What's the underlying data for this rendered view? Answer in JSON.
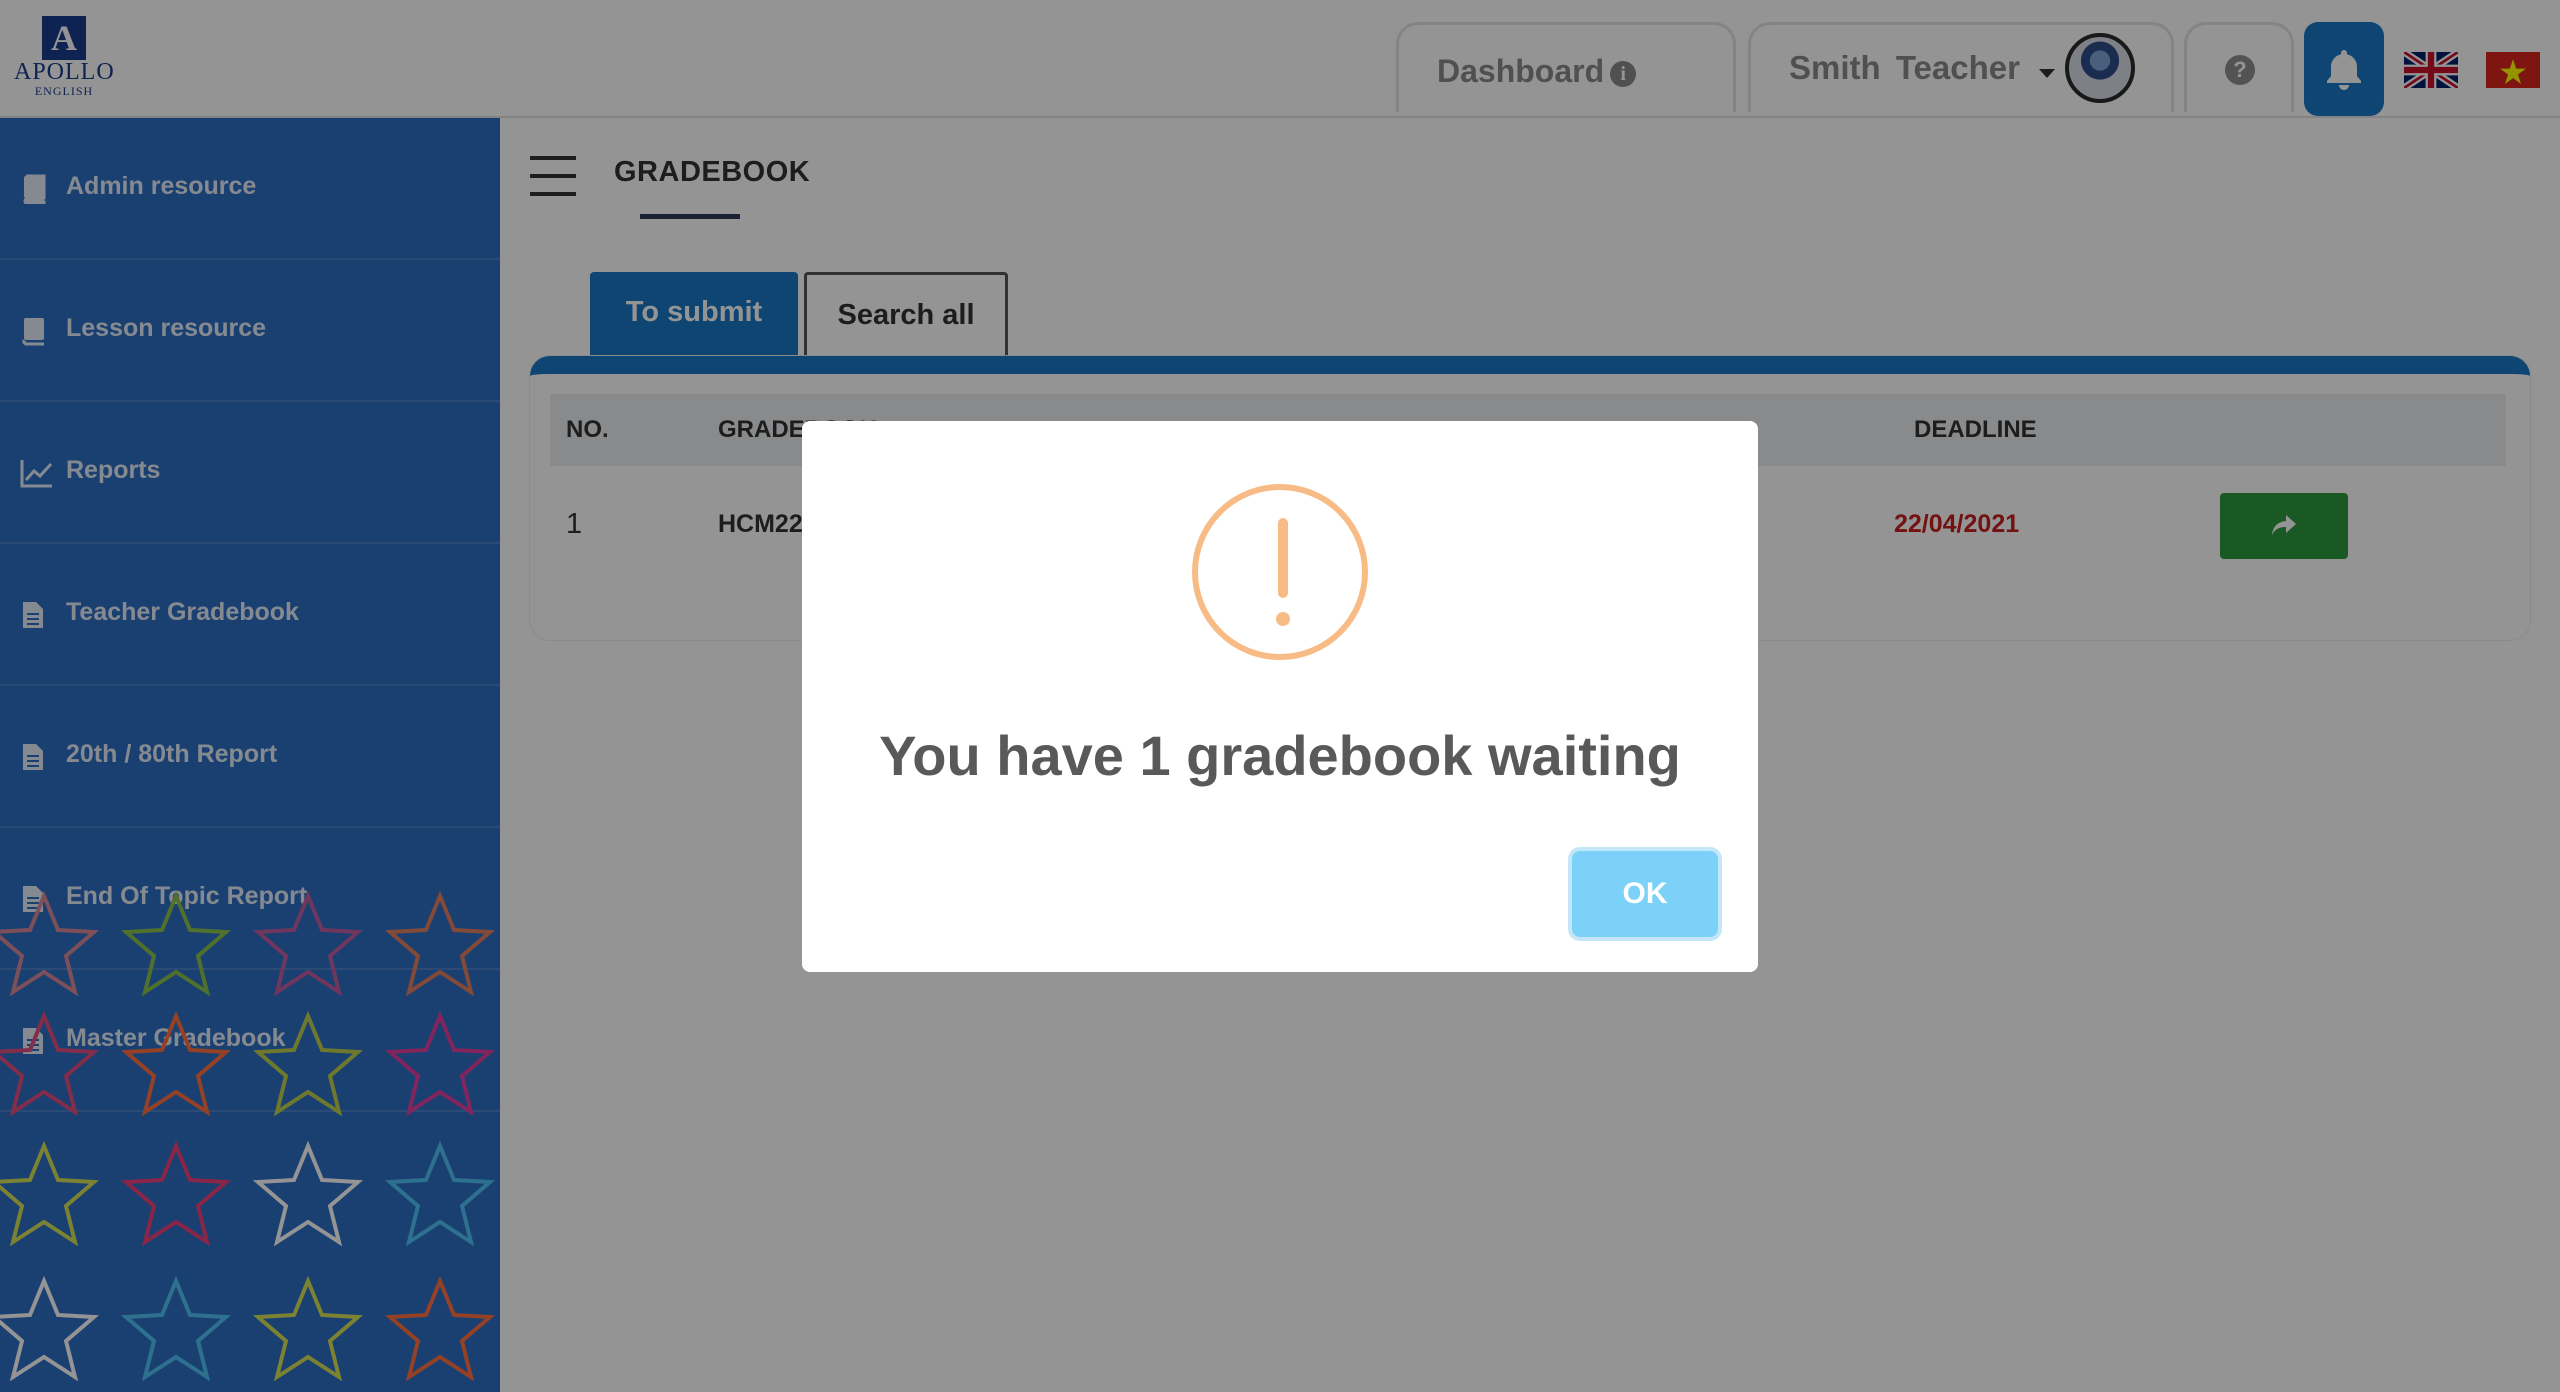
{
  "header": {
    "logo_text": "APOLLO",
    "logo_sub": "ENGLISH",
    "logo_letter": "A",
    "dashboard_label": "Dashboard",
    "user_name": "Smith  Teacher",
    "help_symbol": "?",
    "info_symbol": "i"
  },
  "sidebar": {
    "items": [
      {
        "label": "Admin resource",
        "icon": "book-icon"
      },
      {
        "label": "Lesson resource",
        "icon": "book-icon"
      },
      {
        "label": "Reports",
        "icon": "line-chart-icon"
      },
      {
        "label": "Teacher Gradebook",
        "icon": "file-icon"
      },
      {
        "label": "20th / 80th Report",
        "icon": "file-icon"
      },
      {
        "label": "End Of Topic Report",
        "icon": "file-icon"
      },
      {
        "label": "Master Gradebook",
        "icon": "file-icon"
      }
    ]
  },
  "main": {
    "page_title": "GRADEBOOK",
    "tabs": [
      {
        "label": "To submit",
        "active": true
      },
      {
        "label": "Search all",
        "active": false
      }
    ],
    "table": {
      "columns": [
        "NO.",
        "GRADEBOOK",
        "DEADLINE"
      ],
      "rows": [
        {
          "no": "1",
          "gradebook": "HCM22",
          "deadline": "22/04/2021"
        }
      ]
    }
  },
  "modal": {
    "title": "You have 1 gradebook waiting",
    "ok_label": "OK",
    "icon": "warning-icon"
  },
  "colors": {
    "primary": "#1a78c6",
    "deadline": "#c81e1e",
    "go_button": "#2f9a3e",
    "warning": "#f8bb86",
    "ok_button": "#7cd1f9"
  }
}
